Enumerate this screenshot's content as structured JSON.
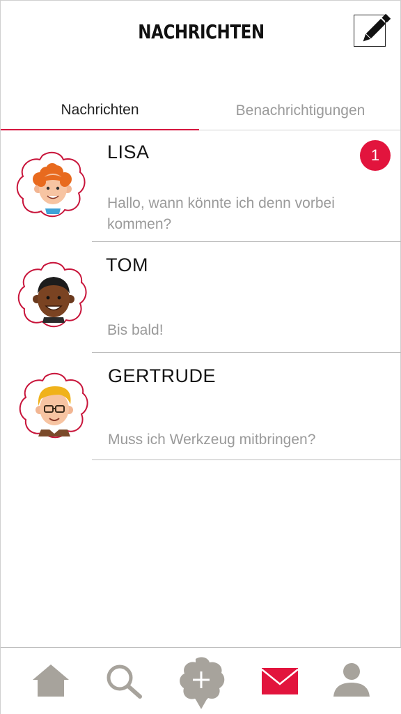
{
  "header": {
    "title": "NACHRICHTEN",
    "compose_icon": "pencil-icon"
  },
  "tabs": [
    {
      "label": "Nachrichten",
      "active": true
    },
    {
      "label": "Benachrichtigungen",
      "active": false
    }
  ],
  "conversations": [
    {
      "name": "LISA",
      "preview": "Hallo, wann könnte ich denn vorbei kommen?",
      "unread": "1",
      "avatar": "red-curly-hair-avatar"
    },
    {
      "name": "TOM",
      "preview": "Bis bald!",
      "avatar": "dark-skin-avatar"
    },
    {
      "name": "GERTRUDE",
      "preview": "Muss ich Werkzeug mitbringen?",
      "avatar": "blonde-glasses-avatar"
    }
  ],
  "bottom_nav": {
    "items": [
      "home-icon",
      "search-icon",
      "add-post-icon",
      "mail-icon",
      "profile-icon"
    ],
    "active": "mail-icon"
  },
  "colors": {
    "accent": "#e2143d",
    "icon_gray": "#a7a39c",
    "text_muted": "#9a9a9a"
  }
}
